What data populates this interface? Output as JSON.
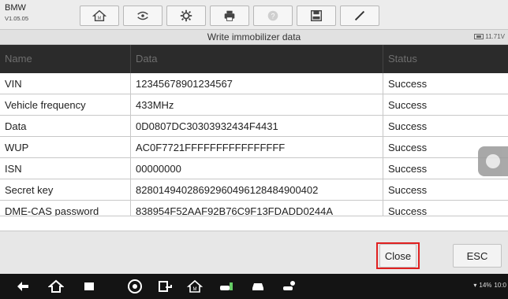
{
  "header": {
    "brand": "BMW",
    "version": "V1.05.05",
    "toolbar_icons": [
      "home-icon",
      "vehicle-swap-icon",
      "gear-icon",
      "print-icon",
      "help-icon",
      "save-icon",
      "pen-icon"
    ]
  },
  "titlebar": {
    "title": "Write immobilizer data",
    "voltage": "11.71V"
  },
  "table": {
    "columns": [
      "Name",
      "Data",
      "Status"
    ],
    "rows": [
      {
        "name": "VIN",
        "data": "12345678901234567",
        "status": "Success"
      },
      {
        "name": "Vehicle frequency",
        "data": "433MHz",
        "status": "Success"
      },
      {
        "name": "Data",
        "data": "0D0807DC30303932434F4431",
        "status": "Success"
      },
      {
        "name": "WUP",
        "data": "AC0F7721FFFFFFFFFFFFFFFF",
        "status": "Success"
      },
      {
        "name": "ISN",
        "data": "00000000",
        "status": "Success"
      },
      {
        "name": "Secret key",
        "data": "82801494028692960496128484900402",
        "status": "Success"
      },
      {
        "name": "DME-CAS password",
        "data": "838954F52AAF92B76C9F13FDADD0244A",
        "status": "Success"
      }
    ]
  },
  "footer": {
    "close_label": "Close",
    "esc_label": "ESC"
  },
  "navbar": {
    "icons": [
      "back-icon",
      "home-icon",
      "recents-icon",
      "chrome-icon",
      "screenshot-icon",
      "vehicle-home-icon",
      "car-diagnostic-icon",
      "car-icon",
      "car-service-icon"
    ],
    "status_text": "14%",
    "clock": "10:0"
  },
  "colors": {
    "header_bg": "#2b2b2b",
    "highlight": "#e02020"
  }
}
